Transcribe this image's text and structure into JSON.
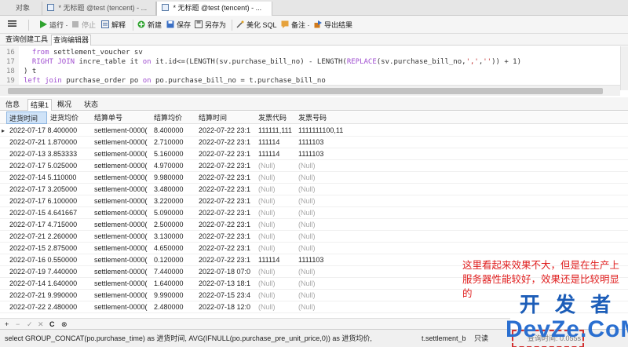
{
  "tabs": [
    {
      "label": "对象"
    },
    {
      "label": "* 无标题 @test (tencent) - ..."
    },
    {
      "label": "* 无标题 @test (tencent) - ..."
    }
  ],
  "toolbar": {
    "menu_icon": "menu-icon",
    "run": "运行 ·",
    "stop": "停止",
    "explain": "解释",
    "new": "新建",
    "save": "保存",
    "save_as": "另存为",
    "beautify": "美化 SQL",
    "comment": "备注 ·",
    "export": "导出结果",
    "colors": {
      "run": "#2fa32f",
      "new": "#2fa32f",
      "save": "#3a6fc4",
      "export": "#d07a1c"
    }
  },
  "subtabs": {
    "builder": "查询创建工具",
    "editor": "查询编辑器"
  },
  "editor": {
    "lines": [
      {
        "n": "16",
        "parts": [
          {
            "t": "  "
          },
          {
            "t": "from",
            "c": "kw"
          },
          {
            "t": " settlement_voucher sv"
          }
        ]
      },
      {
        "n": "17",
        "parts": [
          {
            "t": "  "
          },
          {
            "t": "RIGHT JOIN",
            "c": "kw"
          },
          {
            "t": " incre_table it "
          },
          {
            "t": "on",
            "c": "kw"
          },
          {
            "t": " it.id<=(LENGTH(sv.purchase_bill_no) - LENGTH("
          },
          {
            "t": "REPLACE",
            "c": "kw"
          },
          {
            "t": "(sv.purchase_bill_no,"
          },
          {
            "t": "','",
            "c": "str"
          },
          {
            "t": ","
          },
          {
            "t": "''",
            "c": "str"
          },
          {
            "t": ")) + 1)"
          }
        ]
      },
      {
        "n": "18",
        "parts": [
          {
            "t": ") t"
          }
        ]
      },
      {
        "n": "19",
        "parts": [
          {
            "t": "left join",
            "c": "kw"
          },
          {
            "t": " purchase_order po "
          },
          {
            "t": "on",
            "c": "kw"
          },
          {
            "t": " po.purchase_bill_no = t.purchase_bill_no"
          }
        ]
      }
    ]
  },
  "result_tabs": [
    "信息",
    "结果1",
    "概况",
    "状态"
  ],
  "grid": {
    "columns": [
      "进货时间",
      "进货均价",
      "结算单号",
      "结算均价",
      "结算时间",
      "发票代码",
      "发票号码"
    ],
    "rows": [
      [
        "2022-07-17 8.400000",
        "settlement-0000(",
        "8.400000",
        "2022-07-22 23:1",
        "111111,111",
        "1111111100,11"
      ],
      [
        "2022-07-21 1.870000",
        "settlement-0000(",
        "2.710000",
        "2022-07-22 23:1",
        "111114",
        "1111103"
      ],
      [
        "2022-07-13 3.853333",
        "settlement-0000(",
        "5.160000",
        "2022-07-22 23:1",
        "111114",
        "1111103"
      ],
      [
        "2022-07-17 5.025000",
        "settlement-0000(",
        "4.970000",
        "2022-07-22 23:1",
        "(Null)",
        "(Null)"
      ],
      [
        "2022-07-14 5.110000",
        "settlement-0000(",
        "9.980000",
        "2022-07-22 23:1",
        "(Null)",
        "(Null)"
      ],
      [
        "2022-07-17 3.205000",
        "settlement-0000(",
        "3.480000",
        "2022-07-22 23:1",
        "(Null)",
        "(Null)"
      ],
      [
        "2022-07-17 6.100000",
        "settlement-0000(",
        "3.220000",
        "2022-07-22 23:1",
        "(Null)",
        "(Null)"
      ],
      [
        "2022-07-15 4.641667",
        "settlement-0000(",
        "5.090000",
        "2022-07-22 23:1",
        "(Null)",
        "(Null)"
      ],
      [
        "2022-07-17 4.715000",
        "settlement-0000(",
        "2.500000",
        "2022-07-22 23:1",
        "(Null)",
        "(Null)"
      ],
      [
        "2022-07-21 2.260000",
        "settlement-0000(",
        "3.130000",
        "2022-07-22 23:1",
        "(Null)",
        "(Null)"
      ],
      [
        "2022-07-15 2.875000",
        "settlement-0000(",
        "4.650000",
        "2022-07-22 23:1",
        "(Null)",
        "(Null)"
      ],
      [
        "2022-07-16 0.550000",
        "settlement-0000(",
        "0.120000",
        "2022-07-22 23:1",
        "111114",
        "1111103"
      ],
      [
        "2022-07-19 7.440000",
        "settlement-0000(",
        "7.440000",
        "2022-07-18 07:0",
        "(Null)",
        "(Null)"
      ],
      [
        "2022-07-14 1.640000",
        "settlement-0000(",
        "1.640000",
        "2022-07-13 18:1",
        "(Null)",
        "(Null)"
      ],
      [
        "2022-07-21 9.990000",
        "settlement-0000(",
        "9.990000",
        "2022-07-15 23:4",
        "(Null)",
        "(Null)"
      ],
      [
        "2022-07-22 2.480000",
        "settlement-0000(",
        "2.480000",
        "2022-07-18 12:0",
        "(Null)",
        "(Null)"
      ]
    ]
  },
  "annotation": "这里看起来效果不大，但是在生产上服务器性能较好，效果还是比较明显的",
  "controls": {
    "add": "+",
    "remove": "−",
    "check": "✓",
    "cancel": "✕",
    "refresh": "C",
    "stop": "⊗"
  },
  "status": {
    "sql": "select      GROUP_CONCAT(po.purchase_time) as 进货时间,    AVG(IFNULL(po.purchase_pre_unit_price,0)) as 进货均价,",
    "extra": "t.settlement_b",
    "readonly": "只读",
    "queried": "查询时间: 0.055s"
  },
  "watermark": {
    "top": "开 发 者",
    "bottom": "DevZe.CoM"
  }
}
